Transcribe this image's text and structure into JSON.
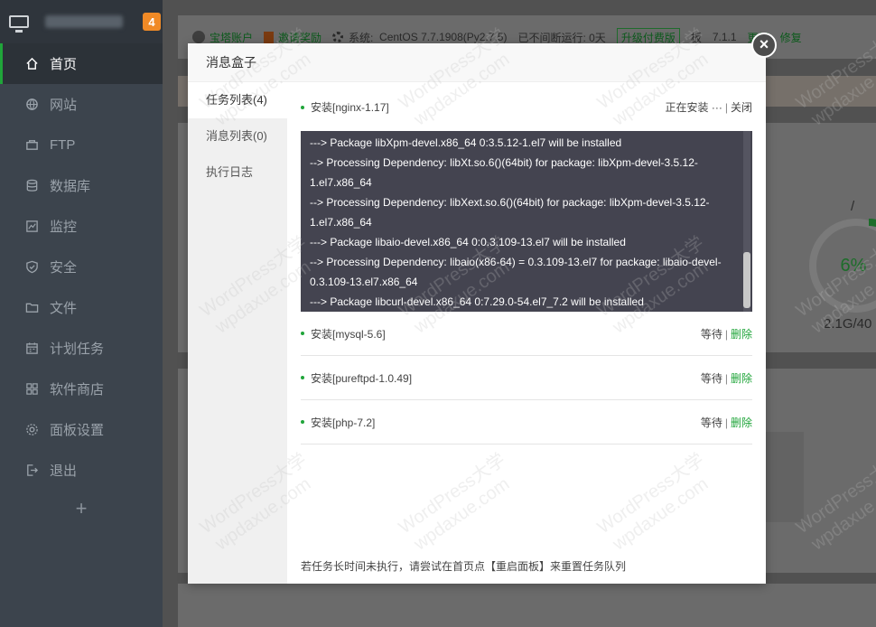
{
  "sidebar": {
    "badge": "4",
    "items": [
      {
        "label": "首页",
        "icon": "home-icon",
        "active": true
      },
      {
        "label": "网站",
        "icon": "globe-icon"
      },
      {
        "label": "FTP",
        "icon": "ftp-icon"
      },
      {
        "label": "数据库",
        "icon": "database-icon"
      },
      {
        "label": "监控",
        "icon": "monitor-icon"
      },
      {
        "label": "安全",
        "icon": "shield-icon"
      },
      {
        "label": "文件",
        "icon": "folder-icon"
      },
      {
        "label": "计划任务",
        "icon": "calendar-icon"
      },
      {
        "label": "软件商店",
        "icon": "grid-icon"
      },
      {
        "label": "面板设置",
        "icon": "gear-icon"
      },
      {
        "label": "退出",
        "icon": "logout-icon"
      }
    ],
    "add": "+"
  },
  "topbar": {
    "account": "宝塔账户",
    "invite": "邀请奖励",
    "system_label": "系统:",
    "system_value": "CentOS 7.7.1908(Py2.7.5)",
    "uptime": "已不间断运行: 0天",
    "upgrade": "升级付费版",
    "panel": "板",
    "version": "7.1.1",
    "update": "更新",
    "repair": "修复"
  },
  "disk": {
    "percent": "6%",
    "size": "2.1G/40",
    "slash": "/"
  },
  "modal": {
    "title": "消息盒子",
    "tabs": [
      "任务列表(4)",
      "消息列表(0)",
      "执行日志"
    ],
    "tasks": [
      {
        "name": "安装[nginx-1.17]",
        "status": "正在安装 ···",
        "action": "关闭"
      },
      {
        "name": "安装[mysql-5.6]",
        "status": "等待",
        "action": "删除"
      },
      {
        "name": "安装[pureftpd-1.0.49]",
        "status": "等待",
        "action": "删除"
      },
      {
        "name": "安装[php-7.2]",
        "status": "等待",
        "action": "删除"
      }
    ],
    "log_lines": [
      "---> Package libXpm-devel.x86_64 0:3.5.12-1.el7 will be installed",
      "--> Processing Dependency: libXt.so.6()(64bit) for package: libXpm-devel-3.5.12-",
      "1.el7.x86_64",
      "--> Processing Dependency: libXext.so.6()(64bit) for package: libXpm-devel-3.5.12-",
      "1.el7.x86_64",
      "---> Package libaio-devel.x86_64 0:0.3.109-13.el7 will be installed",
      "--> Processing Dependency: libaio(x86-64) = 0.3.109-13.el7 for package: libaio-devel-",
      "0.3.109-13.el7.x86_64",
      "---> Package libcurl-devel.x86_64 0:7.29.0-54.el7_7.2 will be installed"
    ],
    "tip": "若任务长时间未执行，请尝试在首页点【重启面板】来重置任务队列",
    "close": "×"
  },
  "watermark": [
    "WordPress大学",
    "wpdaxue.com"
  ]
}
